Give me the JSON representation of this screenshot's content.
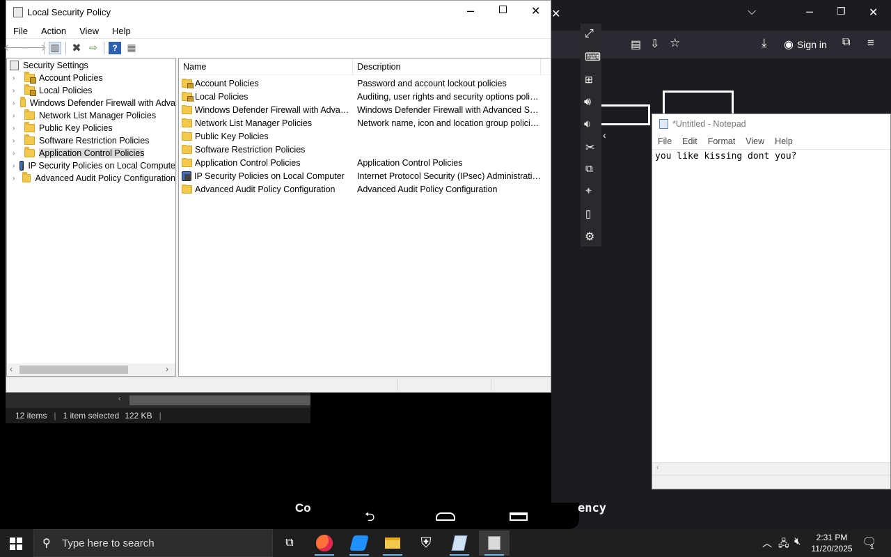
{
  "lsp": {
    "title": "Local Security Policy",
    "menu": [
      "File",
      "Action",
      "View",
      "Help"
    ],
    "toolbar_icons": [
      "back-arrow-icon",
      "forward-arrow-icon",
      "show-hide-tree-icon",
      "delete-icon",
      "export-list-icon",
      "help-icon",
      "properties-icon"
    ],
    "tree_root": "Security Settings",
    "tree_items": [
      {
        "label": "Account Policies",
        "icon": "lock-folder"
      },
      {
        "label": "Local Policies",
        "icon": "lock-folder"
      },
      {
        "label": "Windows Defender Firewall with Adva",
        "icon": "folder"
      },
      {
        "label": "Network List Manager Policies",
        "icon": "folder"
      },
      {
        "label": "Public Key Policies",
        "icon": "folder"
      },
      {
        "label": "Software Restriction Policies",
        "icon": "folder"
      },
      {
        "label": "Application Control Policies",
        "icon": "folder",
        "selected": true
      },
      {
        "label": "IP Security Policies on Local Compute",
        "icon": "ipsec"
      },
      {
        "label": "Advanced Audit Policy Configuration",
        "icon": "folder"
      }
    ],
    "columns": {
      "name": "Name",
      "description": "Description"
    },
    "rows": [
      {
        "name": "Account Policies",
        "description": "Password and account lockout policies",
        "icon": "lock-folder"
      },
      {
        "name": "Local Policies",
        "description": "Auditing, user rights and security options polici...",
        "icon": "lock-folder"
      },
      {
        "name": "Windows Defender Firewall with Advanc...",
        "description": "Windows Defender Firewall with Advanced Sec...",
        "icon": "folder"
      },
      {
        "name": "Network List Manager Policies",
        "description": "Network name, icon and location group policies.",
        "icon": "folder"
      },
      {
        "name": "Public Key Policies",
        "description": "",
        "icon": "folder"
      },
      {
        "name": "Software Restriction Policies",
        "description": "",
        "icon": "folder"
      },
      {
        "name": "Application Control Policies",
        "description": "Application Control Policies",
        "icon": "folder"
      },
      {
        "name": "IP Security Policies on Local Computer",
        "description": "Internet Protocol Security (IPsec) Administratio...",
        "icon": "ipsec"
      },
      {
        "name": "Advanced Audit Policy Configuration",
        "description": "Advanced Audit Policy Configuration",
        "icon": "folder"
      }
    ]
  },
  "explorer_status": {
    "items": "12 items",
    "selected": "1 item selected",
    "size": "122 KB"
  },
  "browser": {
    "sign_in": "Sign in"
  },
  "notepad": {
    "title": "*Untitled - Notepad",
    "menu": [
      "File",
      "Edit",
      "Format",
      "View",
      "Help"
    ],
    "content": "you like kissing dont you?"
  },
  "background_text": {
    "left": "Co",
    "right": "ency"
  },
  "taskbar": {
    "search_placeholder": "Type here to search",
    "time": "2:31 PM",
    "date": "11/20/2025",
    "notification_count": "1"
  }
}
